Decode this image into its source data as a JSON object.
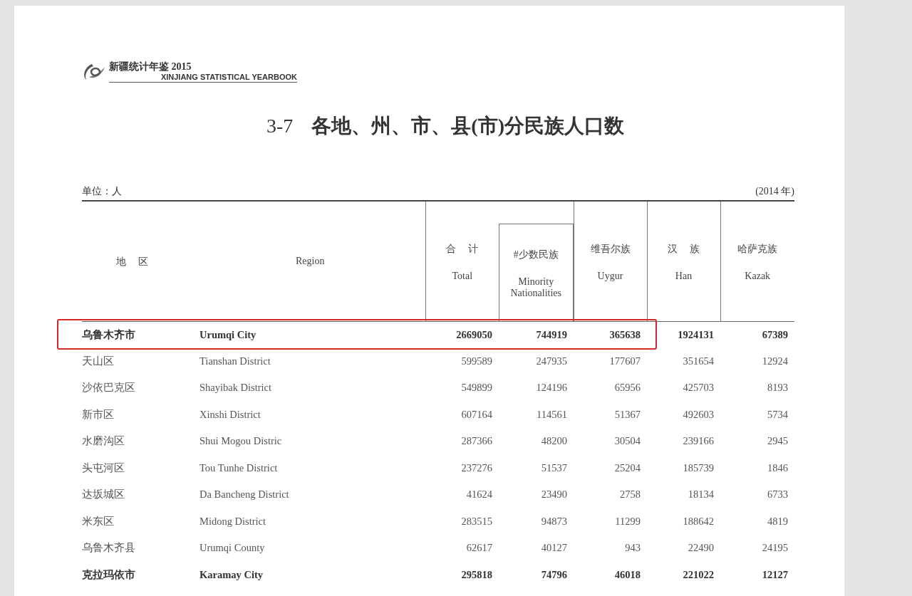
{
  "header": {
    "title_cn": "新疆统计年鉴 2015",
    "title_en": "XINJIANG STATISTICAL YEARBOOK"
  },
  "table_title": {
    "number": "3-7",
    "text": "各地、州、市、县(市)分民族人口数"
  },
  "unit": "单位：人",
  "year": "(2014 年)",
  "table": {
    "columns": [
      {
        "kind": "label",
        "cn": "地区"
      },
      {
        "kind": "label",
        "en": "Region"
      },
      {
        "kind": "value",
        "cn": "合计",
        "en": "Total"
      },
      {
        "kind": "subvalue",
        "cn": "#少数民族",
        "en": "Minority Nationalities"
      },
      {
        "kind": "value",
        "cn": "维吾尔族",
        "en": "Uygur"
      },
      {
        "kind": "value",
        "cn": "汉族",
        "en": "Han"
      },
      {
        "kind": "value",
        "cn": "哈萨克族",
        "en": "Kazak"
      }
    ],
    "rows": [
      {
        "kind": "city",
        "highlighted": true,
        "cells": [
          "乌鲁木齐市",
          "Urumqi City",
          "2669050",
          "744919",
          "365638",
          "1924131",
          "67389"
        ]
      },
      {
        "kind": "district",
        "highlighted": false,
        "cells": [
          "天山区",
          "Tianshan District",
          "599589",
          "247935",
          "177607",
          "351654",
          "12924"
        ]
      },
      {
        "kind": "district",
        "highlighted": false,
        "cells": [
          "沙依巴克区",
          "Shayibak District",
          "549899",
          "124196",
          "65956",
          "425703",
          "8193"
        ]
      },
      {
        "kind": "district",
        "highlighted": false,
        "cells": [
          "新市区",
          "Xinshi District",
          "607164",
          "114561",
          "51367",
          "492603",
          "5734"
        ]
      },
      {
        "kind": "district",
        "highlighted": false,
        "cells": [
          "水磨沟区",
          "Shui Mogou Distric",
          "287366",
          "48200",
          "30504",
          "239166",
          "2945"
        ]
      },
      {
        "kind": "district",
        "highlighted": false,
        "cells": [
          "头屯河区",
          "Tou Tunhe District",
          "237276",
          "51537",
          "25204",
          "185739",
          "1846"
        ]
      },
      {
        "kind": "district",
        "highlighted": false,
        "cells": [
          "达坂城区",
          "Da Bancheng District",
          "41624",
          "23490",
          "2758",
          "18134",
          "6733"
        ]
      },
      {
        "kind": "district",
        "highlighted": false,
        "cells": [
          "米东区",
          "Midong District",
          "283515",
          "94873",
          "11299",
          "188642",
          "4819"
        ]
      },
      {
        "kind": "district",
        "highlighted": false,
        "cells": [
          "乌鲁木齐县",
          "Urumqi County",
          "62617",
          "40127",
          "943",
          "22490",
          "24195"
        ]
      },
      {
        "kind": "city",
        "highlighted": false,
        "cells": [
          "克拉玛依市",
          "Karamay City",
          "295818",
          "74796",
          "46018",
          "221022",
          "12127"
        ]
      }
    ]
  }
}
